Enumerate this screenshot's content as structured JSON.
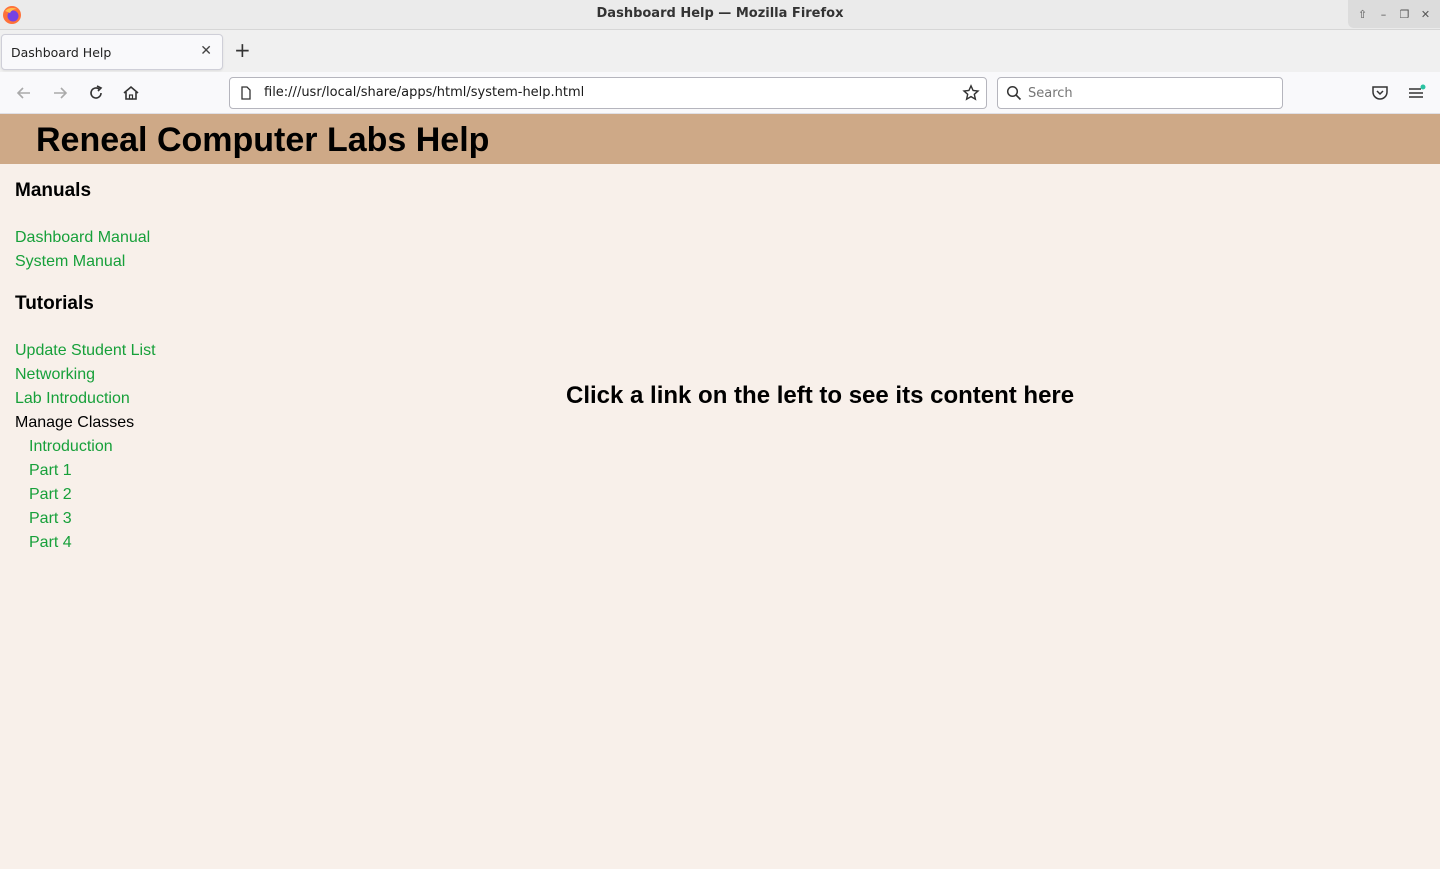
{
  "window": {
    "title": "Dashboard Help — Mozilla Firefox",
    "controls": [
      "up-arrow-icon",
      "minimize-icon",
      "restore-icon",
      "close-icon"
    ]
  },
  "tabs": [
    {
      "label": "Dashboard Help",
      "active": true
    }
  ],
  "navbar": {
    "url": "file:///usr/local/share/apps/html/system-help.html",
    "search_placeholder": "Search"
  },
  "page": {
    "heading": "Reneal Computer Labs Help",
    "header_color": "#cea987",
    "background_color": "#f8f0ea",
    "link_color": "#17a03a",
    "sidebar": {
      "manuals_heading": "Manuals",
      "manuals": [
        "Dashboard Manual",
        "System Manual"
      ],
      "tutorials_heading": "Tutorials",
      "tutorials": [
        "Update Student List",
        "Networking",
        "Lab Introduction"
      ],
      "manage_classes": {
        "label": "Manage Classes",
        "items": [
          "Introduction",
          "Part 1",
          "Part 2",
          "Part 3",
          "Part 4"
        ]
      }
    },
    "content_message": "Click a link on the left to see its content here"
  }
}
